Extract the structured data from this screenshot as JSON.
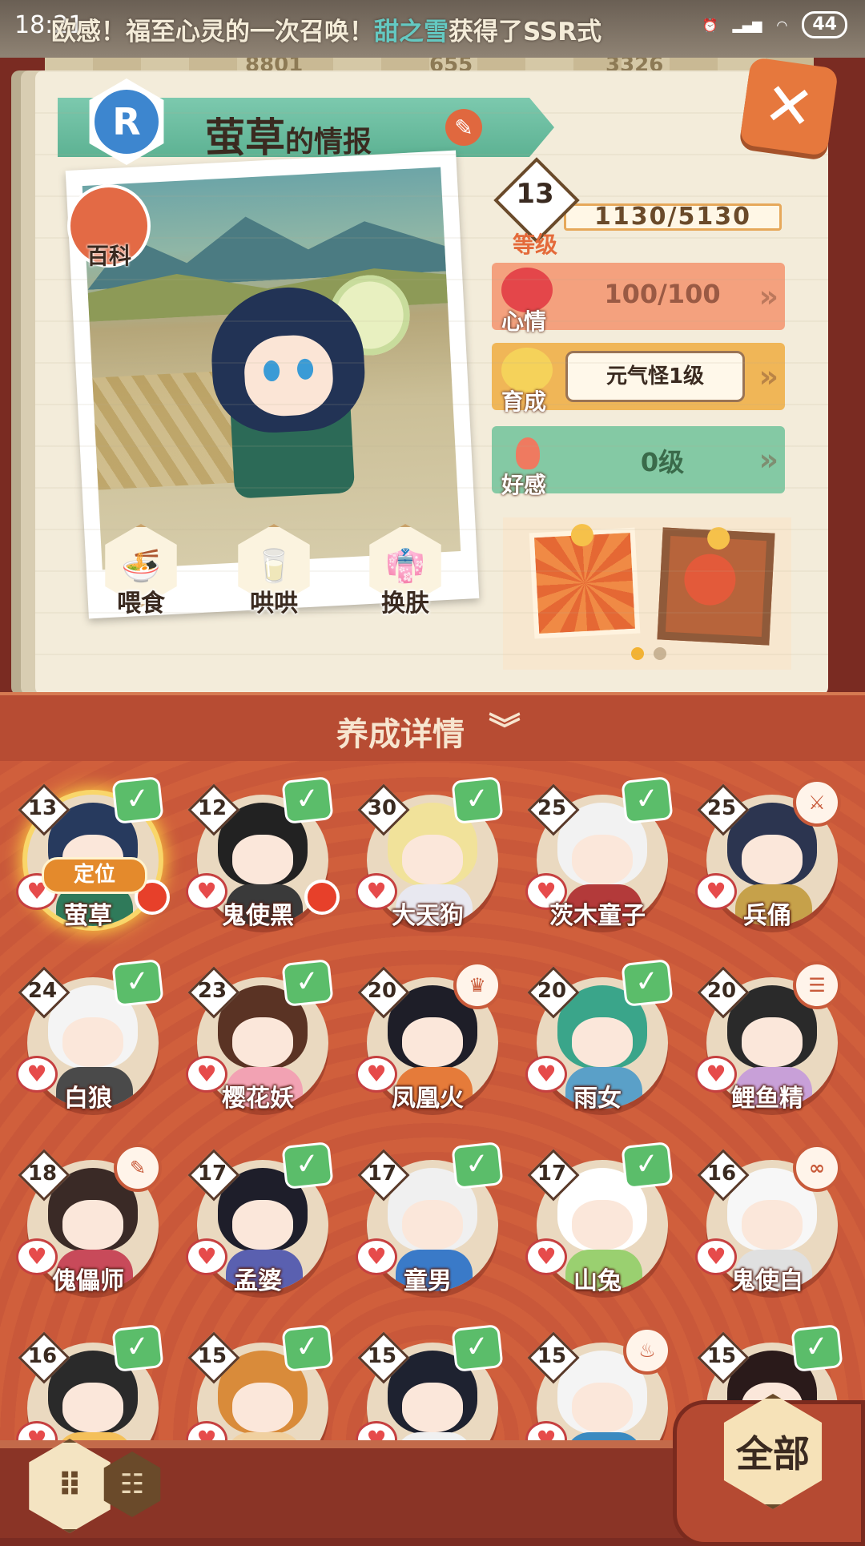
{
  "status_bar": {
    "time": "18:21",
    "ticker_prefix": "欧感！福至心灵的一次召唤！",
    "ticker_player": "甜之雪",
    "ticker_suffix": "获得了SSR式",
    "battery": "44"
  },
  "score_strip": [
    "8801",
    "655",
    "3326"
  ],
  "panel": {
    "rarity": "R",
    "shikigami_name": "萤草",
    "title_suffix": "的情报",
    "encyclopedia_label": "百科",
    "level": "13",
    "level_label": "等级",
    "xp": "1130/5130",
    "mood_label": "心情",
    "mood_value": "100/100",
    "training_label": "育成",
    "training_value": "元气怪1级",
    "favor_label": "好感",
    "favor_value": "0级",
    "actions": [
      {
        "label": "喂食",
        "icon": "🍜"
      },
      {
        "label": "哄哄",
        "icon": "🥛"
      },
      {
        "label": "换肤",
        "icon": "👘"
      }
    ]
  },
  "detail_header": "养成详情",
  "shikigami": [
    {
      "name": "萤草",
      "level": "13",
      "badge": "check",
      "selected": true,
      "locate": "定位",
      "hair": "#273a5e",
      "cloth": "#2f7a5a"
    },
    {
      "name": "鬼使黑",
      "level": "12",
      "badge": "check",
      "hair": "#222222",
      "cloth": "#3a3a3a"
    },
    {
      "name": "大天狗",
      "level": "30",
      "badge": "check",
      "hair": "#f1e29a",
      "cloth": "#e8e8f0"
    },
    {
      "name": "茨木童子",
      "level": "25",
      "badge": "check",
      "hair": "#f2f2f2",
      "cloth": "#b33a3a"
    },
    {
      "name": "兵俑",
      "level": "25",
      "badge": "job",
      "job_icon": "⚔",
      "hair": "#2c3550",
      "cloth": "#c6a14a"
    },
    {
      "name": "白狼",
      "level": "24",
      "badge": "check",
      "hair": "#f4f4f4",
      "cloth": "#4a4a4a"
    },
    {
      "name": "樱花妖",
      "level": "23",
      "badge": "check",
      "hair": "#5a3324",
      "cloth": "#f2a2b3"
    },
    {
      "name": "凤凰火",
      "level": "20",
      "badge": "job",
      "job_icon": "♛",
      "hair": "#1e1e28",
      "cloth": "#e57b3a"
    },
    {
      "name": "雨女",
      "level": "20",
      "badge": "check",
      "hair": "#3aa58a",
      "cloth": "#5aa0c8"
    },
    {
      "name": "鲤鱼精",
      "level": "20",
      "badge": "job",
      "job_icon": "☰",
      "hair": "#2a2a2a",
      "cloth": "#c8a0d8"
    },
    {
      "name": "傀儡师",
      "level": "18",
      "badge": "job",
      "job_icon": "✎",
      "hair": "#3a2a26",
      "cloth": "#c84a5a"
    },
    {
      "name": "孟婆",
      "level": "17",
      "badge": "check",
      "hair": "#1e1e2a",
      "cloth": "#5a60b0"
    },
    {
      "name": "童男",
      "level": "17",
      "badge": "check",
      "hair": "#f0f0f0",
      "cloth": "#3a7ac8"
    },
    {
      "name": "山兔",
      "level": "17",
      "badge": "check",
      "hair": "#ffffff",
      "cloth": "#9ad070"
    },
    {
      "name": "鬼使白",
      "level": "16",
      "badge": "job",
      "job_icon": "∞",
      "hair": "#f7f7f7",
      "cloth": "#e0e0e0"
    },
    {
      "name": "",
      "level": "16",
      "badge": "check",
      "hair": "#2a2a2a",
      "cloth": "#f4c05a"
    },
    {
      "name": "",
      "level": "15",
      "badge": "check",
      "hair": "#d98b3a",
      "cloth": "#f0d0a0"
    },
    {
      "name": "",
      "level": "15",
      "badge": "check",
      "hair": "#1e2230",
      "cloth": "#f0f0f0"
    },
    {
      "name": "",
      "level": "15",
      "badge": "job",
      "job_icon": "♨",
      "hair": "#f4f4f4",
      "cloth": "#3a8ac0"
    },
    {
      "name": "",
      "level": "15",
      "badge": "check",
      "hair": "#2a1a1a",
      "cloth": "#a03030"
    }
  ],
  "bottom": {
    "filter_all": "全部"
  },
  "colors": {
    "panel_bg": "#f3ecda",
    "header_bar": "#b74c33",
    "grid_bg": "#c9583a",
    "mood": "#f4a17e",
    "training": "#f0b657",
    "favor": "#84c9a4",
    "check": "#5bbd6a"
  }
}
